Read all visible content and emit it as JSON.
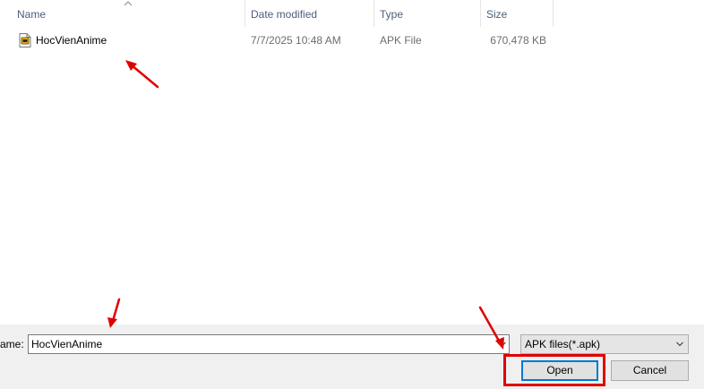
{
  "columns": {
    "name": "Name",
    "date_modified": "Date modified",
    "type": "Type",
    "size": "Size"
  },
  "files": [
    {
      "name": "HocVienAnime",
      "date_modified": "7/7/2025 10:48 AM",
      "type": "APK File",
      "size": "670,478 KB",
      "icon": "apk-file-icon"
    }
  ],
  "footer": {
    "filename_label": "ame:",
    "filename_value": "HocVienAnime",
    "filetype_selected": "APK files(*.apk)",
    "open_label": "Open",
    "cancel_label": "Cancel"
  },
  "colors": {
    "annotation": "#e00000",
    "focus_border": "#0078d7",
    "header_text": "#4c607a"
  }
}
